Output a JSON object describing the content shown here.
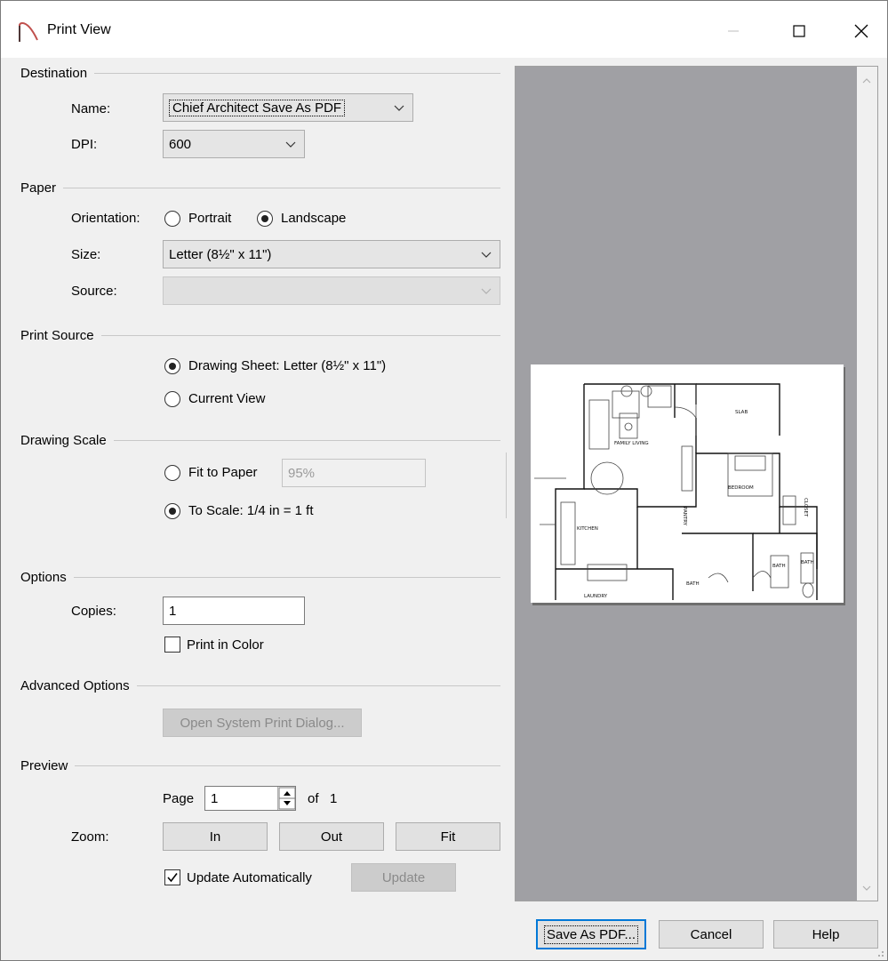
{
  "window": {
    "title": "Print View"
  },
  "destination": {
    "group_label": "Destination",
    "name_label": "Name:",
    "name_value": "Chief Architect Save As PDF",
    "dpi_label": "DPI:",
    "dpi_value": "600"
  },
  "paper": {
    "group_label": "Paper",
    "orientation_label": "Orientation:",
    "portrait_label": "Portrait",
    "landscape_label": "Landscape",
    "orientation_selected": "Landscape",
    "size_label": "Size:",
    "size_value": "Letter  (8½\" x 11\")",
    "source_label": "Source:",
    "source_value": ""
  },
  "print_source": {
    "group_label": "Print Source",
    "drawing_sheet_label": "Drawing Sheet: Letter  (8½\" x 11\")",
    "current_view_label": "Current View",
    "selected": "Drawing Sheet"
  },
  "drawing_scale": {
    "group_label": "Drawing Scale",
    "fit_label": "Fit to Paper",
    "fit_value": "95%",
    "to_scale_label": "To Scale: 1/4 in = 1 ft",
    "selected": "To Scale"
  },
  "options": {
    "group_label": "Options",
    "copies_label": "Copies:",
    "copies_value": "1",
    "print_color_label": "Print in Color",
    "print_color_checked": false
  },
  "advanced": {
    "group_label": "Advanced Options",
    "system_dialog_label": "Open System Print Dialog..."
  },
  "preview": {
    "group_label": "Preview",
    "page_label": "Page",
    "page_value": "1",
    "of_label": "of",
    "page_count": "1",
    "zoom_label": "Zoom:",
    "zoom_in": "In",
    "zoom_out": "Out",
    "zoom_fit": "Fit",
    "update_auto_label": "Update Automatically",
    "update_auto_checked": true,
    "update_button": "Update"
  },
  "floorplan_labels": {
    "family": "FAMILY LIVING",
    "slab": "SLAB",
    "bedroom": "BEDROOM",
    "kitchen": "KITCHEN",
    "closet": "CLOSET",
    "pantry": "PANTRY",
    "bath1": "BATH",
    "bath2": "BATH",
    "bath3": "BATH",
    "laundry": "LAUNDRY"
  },
  "footer": {
    "save_pdf": "Save As PDF...",
    "cancel": "Cancel",
    "help": "Help"
  },
  "colors": {
    "accent": "#0078d7",
    "preview_bg": "#a0a0a4",
    "dialog_bg": "#f0f0f0",
    "logo": "#c0504d"
  }
}
